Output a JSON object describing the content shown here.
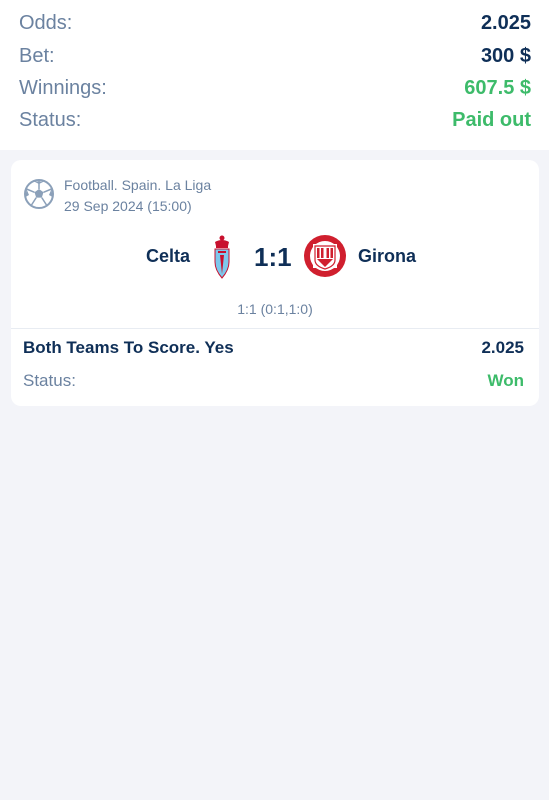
{
  "summary": {
    "odds_label": "Odds:",
    "odds_value": "2.025",
    "bet_label": "Bet:",
    "bet_value": "300 $",
    "winnings_label": "Winnings:",
    "winnings_value": "607.5 $",
    "status_label": "Status:",
    "status_value": "Paid out"
  },
  "event": {
    "league": "Football. Spain. La Liga",
    "datetime": "29 Sep 2024 (15:00)",
    "home_team": "Celta",
    "away_team": "Girona",
    "score": "1:1",
    "half_scores": "1:1 (0:1,1:0)",
    "sport_icon": "football-icon",
    "home_crest_icon": "celta-crest-icon",
    "away_crest_icon": "girona-crest-icon"
  },
  "pick": {
    "market": "Both Teams To Score. Yes",
    "odds": "2.025",
    "status_label": "Status:",
    "status_value": "Won"
  },
  "colors": {
    "primary_text": "#0f2f57",
    "secondary_text": "#6b82a0",
    "success": "#3dbb6a",
    "background": "#f3f4f9"
  }
}
